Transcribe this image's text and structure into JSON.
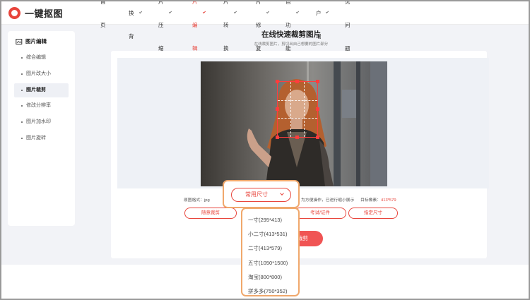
{
  "app": {
    "name": "一键抠图",
    "brand_color": "#e8453c"
  },
  "nav": [
    {
      "label": "首页",
      "dropdown": false,
      "active": false
    },
    {
      "label": "抠图换背景",
      "dropdown": true,
      "active": false
    },
    {
      "label": "图片压缩",
      "dropdown": true,
      "active": false
    },
    {
      "label": "图片编辑",
      "dropdown": true,
      "active": true
    },
    {
      "label": "图片转换",
      "dropdown": true,
      "active": false
    },
    {
      "label": "照片修复",
      "dropdown": true,
      "active": false
    },
    {
      "label": "特色功能",
      "dropdown": true,
      "active": false
    },
    {
      "label": "客户端",
      "dropdown": true,
      "active": false
    },
    {
      "label": "常见问题",
      "dropdown": false,
      "active": false
    }
  ],
  "sidebar": {
    "title": "图片编辑",
    "items": [
      {
        "label": "综合编辑",
        "active": false
      },
      {
        "label": "图片改大小",
        "active": false
      },
      {
        "label": "图片裁剪",
        "active": true
      },
      {
        "label": "修改分辨率",
        "active": false
      },
      {
        "label": "图片加水印",
        "active": false
      },
      {
        "label": "图片旋转",
        "active": false
      }
    ]
  },
  "main": {
    "title": "在线快速裁剪图片",
    "subtitle": "在线裁剪图片，剪切出自己想要的图片部分",
    "info_left": "原图格式：jpg",
    "info_mid": "为方便操作，已进行缩小展示",
    "info_right_label": "目标像素：",
    "info_right_value": "413*579",
    "buttons": {
      "free_crop": "随意裁剪",
      "exam_id": "考试/证件",
      "custom_size": "指定尺寸"
    },
    "start_label": "裁剪"
  },
  "dropdown": {
    "selected": "常用尺寸",
    "options": [
      "一寸(295*413)",
      "小二寸(413*531)",
      "二寸(413*579)",
      "五寸(1050*1500)",
      "淘宝(800*800)",
      "拼多多(750*352)"
    ]
  }
}
